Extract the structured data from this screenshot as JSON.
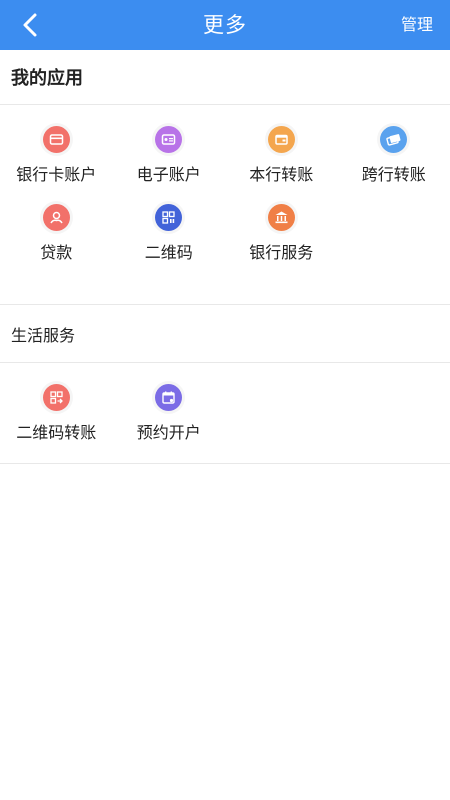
{
  "header": {
    "title": "更多",
    "manage_label": "管理",
    "bg_color": "#3c8df0"
  },
  "my_apps": {
    "title": "我的应用",
    "items": [
      {
        "label": "银行卡账户",
        "icon": "card-icon",
        "color": "#f2716a"
      },
      {
        "label": "电子账户",
        "icon": "id-card-icon",
        "color": "#b873e8"
      },
      {
        "label": "本行转账",
        "icon": "wallet-icon",
        "color": "#f4a64e"
      },
      {
        "label": "跨行转账",
        "icon": "cards-icon",
        "color": "#5aa2ee"
      },
      {
        "label": "贷款",
        "icon": "loan-icon",
        "color": "#f2716a"
      },
      {
        "label": "二维码",
        "icon": "qr-code-icon",
        "color": "#4263d9"
      },
      {
        "label": "银行服务",
        "icon": "bank-icon",
        "color": "#f07f46"
      }
    ]
  },
  "life_services": {
    "title": "生活服务",
    "items": [
      {
        "label": "二维码转账",
        "icon": "qr-transfer-icon",
        "color": "#f2716a"
      },
      {
        "label": "预约开户",
        "icon": "calendar-icon",
        "color": "#7b6ce6"
      }
    ]
  }
}
